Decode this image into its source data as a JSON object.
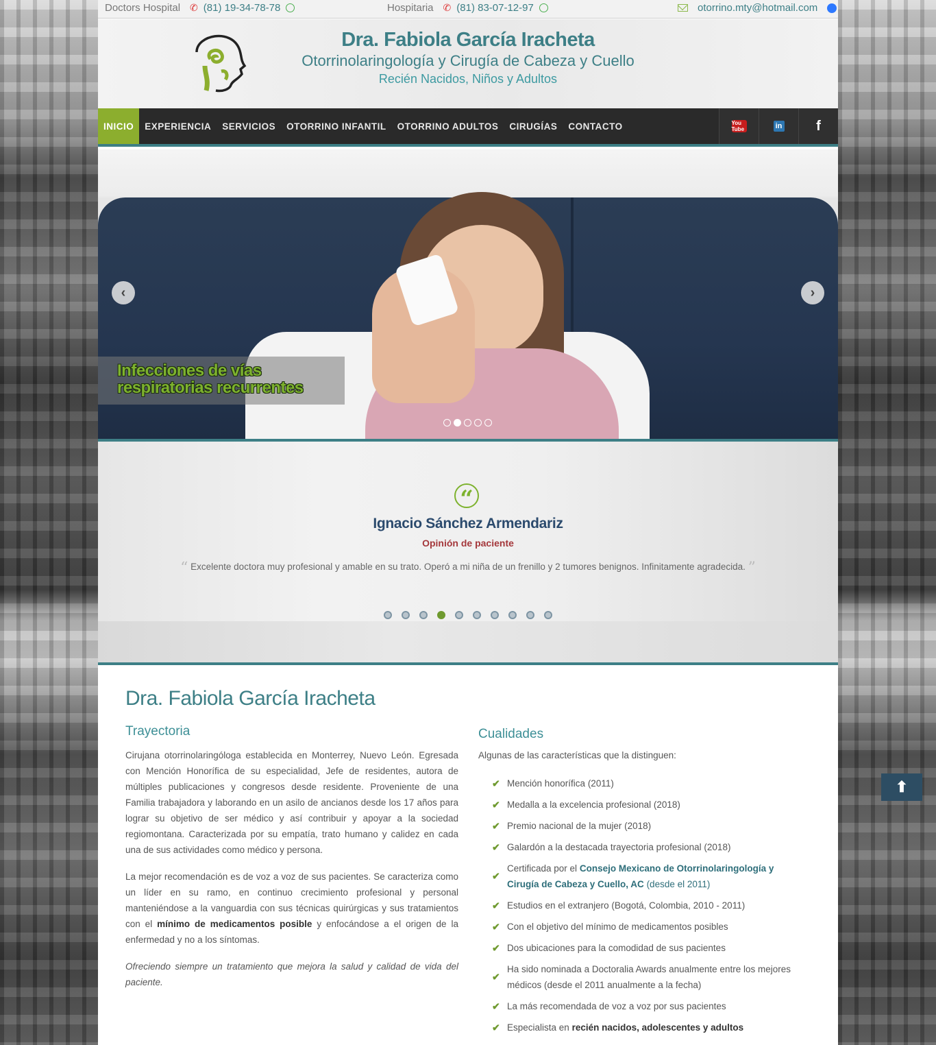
{
  "topbar": {
    "hospital1": "Doctors Hospital",
    "phone1": "(81) 19-34-78-78",
    "hospital2": "Hospitaria",
    "phone2": "(81) 83-07-12-97",
    "email": "otorrino.mty@hotmail.com"
  },
  "header": {
    "title": "Dra. Fabiola García Iracheta",
    "subtitle": "Otorrinolaringología y Cirugía de Cabeza y Cuello",
    "tagline": "Recién Nacidos, Niños y Adultos"
  },
  "nav": {
    "items": [
      "INICIO",
      "EXPERIENCIA",
      "SERVICIOS",
      "OTORRINO INFANTIL",
      "OTORRINO ADULTOS",
      "CIRUGÍAS",
      "CONTACTO"
    ],
    "active_index": 0,
    "social": [
      "youtube-icon",
      "linkedin-icon",
      "facebook-icon"
    ],
    "youtube_text": "You Tube",
    "linkedin_text": "in",
    "facebook_text": "f"
  },
  "slider": {
    "caption": "Infecciones de vías respiratorias recurrentes",
    "dot_count": 5,
    "active_dot": 1
  },
  "testimonial": {
    "name": "Ignacio Sánchez Armendariz",
    "role": "Opinión de paciente",
    "text": "Excelente doctora muy profesional y amable en su trato. Operó a mi niña de un frenillo y 2 tumores benignos. Infinitamente agradecida.",
    "dot_count": 10,
    "active_dot": 3
  },
  "content": {
    "title": "Dra. Fabiola García Iracheta",
    "trayectoria": {
      "heading": "Trayectoria",
      "p1": "Cirujana otorrinolaringóloga establecida en Monterrey, Nuevo León. Egresada con Mención Honorífica de su especialidad, Jefe de residentes, autora de múltiples publicaciones y congresos desde residente. Proveniente de una Familia trabajadora y laborando en un asilo de ancianos desde los 17 años para lograr su objetivo de ser médico y así contribuir y apoyar a la sociedad regiomontana. Caracterizada por su empatía, trato humano y calidez en cada una de sus actividades como médico y persona.",
      "p2_start": "La mejor recomendación es de voz a voz de sus pacientes. Se caracteriza como un líder en su ramo, en continuo crecimiento profesional y personal manteniéndose a la vanguardia con sus técnicas quirúrgicas y sus tratamientos con el",
      "p2_bold": "mínimo de medicamentos posible",
      "p2_end": "y enfocándose a el origen de la enfermedad y no a los síntomas.",
      "p3": "Ofreciendo siempre un tratamiento que mejora la salud y calidad de vida del paciente."
    },
    "cualidades": {
      "heading": "Cualidades",
      "intro": "Algunas de las características que la distinguen:",
      "items": [
        "Mención honorífica (2011)",
        "Medalla a la excelencia profesional (2018)",
        "Premio nacional de la mujer (2018)",
        "Galardón a la destacada trayectoria profesional (2018)",
        "Estudios en el extranjero (Bogotá, Colombia, 2010 - 2011)",
        "Con el objetivo del mínimo de medicamentos posibles",
        "Dos ubicaciones para la comodidad de sus pacientes",
        "Ha sido nominada a Doctoralia Awards anualmente entre los mejores médicos (desde el 2011 anualmente a la fecha)",
        "La más recomendada de voz a voz por sus pacientes"
      ],
      "cert_start": "Certificada por el",
      "cert_link": "Consejo Mexicano de Otorrinolaringología y Cirugía de Cabeza y Cuello, AC",
      "cert_end": "(desde el 2011)",
      "spec_start": "Especialista en",
      "spec_bold": "recién nacidos, adolescentes y adultos"
    }
  },
  "colors": {
    "teal": "#3d7f86",
    "green": "#8cae2e",
    "nav_bg": "#2a2a2a"
  }
}
